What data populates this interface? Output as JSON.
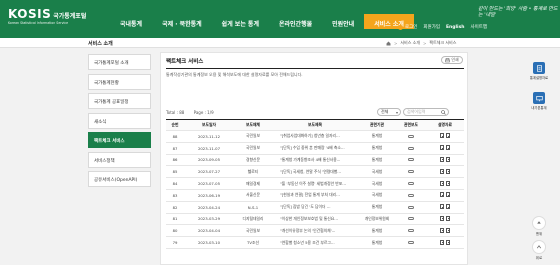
{
  "header": {
    "brand": "KOSIS",
    "brand_kr": "국가통계포털",
    "brand_en": "Korean Statistical Information Service",
    "slogan": "같이 만드는 '희망' 사람 • 통계로 만드는 '내일'",
    "nav": [
      "국내통계",
      "국제 · 북한통계",
      "쉽게 보는 통계",
      "온라인간행물",
      "민원안내",
      "서비스 소개"
    ],
    "nav_active_index": 5,
    "util": [
      "로그인",
      "회원가입",
      "English",
      "사이트맵"
    ]
  },
  "section_title": "서비스 소개",
  "breadcrumb": [
    "서비스 소개",
    "팩트체크 서비스"
  ],
  "left_menu": [
    "국가통계포털 소개",
    "국가통계현황",
    "국가통계 공표일정",
    "새소식",
    "팩트체크 서비스",
    "서비스정책",
    "공유서비스(OpenAPI)"
  ],
  "left_menu_active_index": 4,
  "content": {
    "title": "팩트체크 서비스",
    "print_label": "인쇄",
    "description": "통계작성기관의 통계정보 오용 및 해석보도에 대한 설명자료를 모아 전해드립니다.",
    "total_label": "Total : 88",
    "page_label": "Page : 1/9",
    "filter_select": "전체",
    "search_placeholder": "검색어입력",
    "columns": [
      "순번",
      "보도일자",
      "보도매체",
      "보도제목",
      "관련기관",
      "관련보도",
      "설명자료"
    ],
    "rows": [
      {
        "no": "88",
        "date": "2023-11-12",
        "media": "국민일보",
        "title": "\"[취업사업대화하기] 청년층 일자리…",
        "agency": "통계청"
      },
      {
        "no": "87",
        "date": "2023-11-07",
        "media": "국민일보",
        "title": "\"[단독] 수입 중위 흔 판매량 '4배 축소…",
        "agency": "통계청"
      },
      {
        "no": "86",
        "date": "2023-09-05",
        "media": "경향신문",
        "title": "\"통계청 가계동향조사 4배 통신사용…",
        "agency": "통계청"
      },
      {
        "no": "85",
        "date": "2023-07-27",
        "media": "헬로티",
        "title": "\"[단독] 국세청, 연말 주식 '연령대별…",
        "agency": "국세청"
      },
      {
        "no": "84",
        "date": "2023-07-05",
        "media": "매일경제",
        "title": "\"올 '부동산 이주 설명' 세법개정안 반포…",
        "agency": "국세청"
      },
      {
        "no": "83",
        "date": "2023-06-19",
        "media": "서울신문",
        "title": "\"[현실과 연결] 전업 통계 부처 대리…",
        "agency": "국세청"
      },
      {
        "no": "82",
        "date": "2023-04-24",
        "media": "N-S-1",
        "title": "\"[단독] 집밥 당긴 '도 담이더 …",
        "agency": "통계청"
      },
      {
        "no": "81",
        "date": "2023-03-29",
        "media": "디지털데일리",
        "title": "\"이상한 개인정보보호법 및 통신요…",
        "agency": "개인정보위원회"
      },
      {
        "no": "80",
        "date": "2023-04-04",
        "media": "국민일보",
        "title": "\"개선이유정부 논의 '인건협의체'…",
        "agency": "통계청"
      },
      {
        "no": "79",
        "date": "2023-03-10",
        "media": "TV조선",
        "title": "\"연합별 청소년 5용 조건 부르그…",
        "agency": "통계청"
      }
    ]
  },
  "quick_menu": [
    "통계설명자료",
    "내가본통계"
  ],
  "side_buttons": [
    "맨위",
    "위로"
  ],
  "colors": {
    "primary": "#1a7f4a",
    "accent": "#f4a51c",
    "quick": "#2a6fb5"
  }
}
